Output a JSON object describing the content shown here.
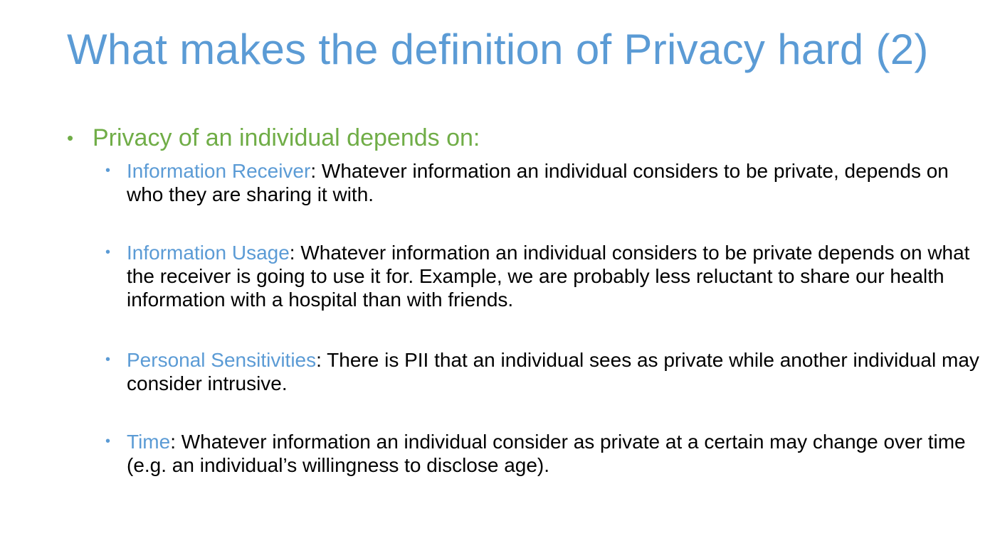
{
  "slide": {
    "title": "What makes the definition of Privacy hard (2)",
    "main_bullet": "Privacy of an individual depends on:",
    "items": [
      {
        "term": "Information Receiver",
        "text": ": Whatever information an individual considers to be private, depends on who they are sharing it with."
      },
      {
        "term": "Information Usage",
        "text": ": Whatever information an individual considers to be private depends on what the receiver is going to use it for. Example, we are probably less reluctant to share our health information with a hospital than with friends."
      },
      {
        "term": "Personal Sensitivities",
        "text": ": There is PII that an individual sees as private while another individual may consider intrusive."
      },
      {
        "term": "Time",
        "text": ": Whatever information an individual consider as private at a certain may change over time (e.g. an individual’s willingness to disclose age)."
      }
    ]
  },
  "colors": {
    "title": "#5b9bd5",
    "main_bullet": "#70ad47",
    "term": "#5b9bd5",
    "body_text": "#000000"
  }
}
